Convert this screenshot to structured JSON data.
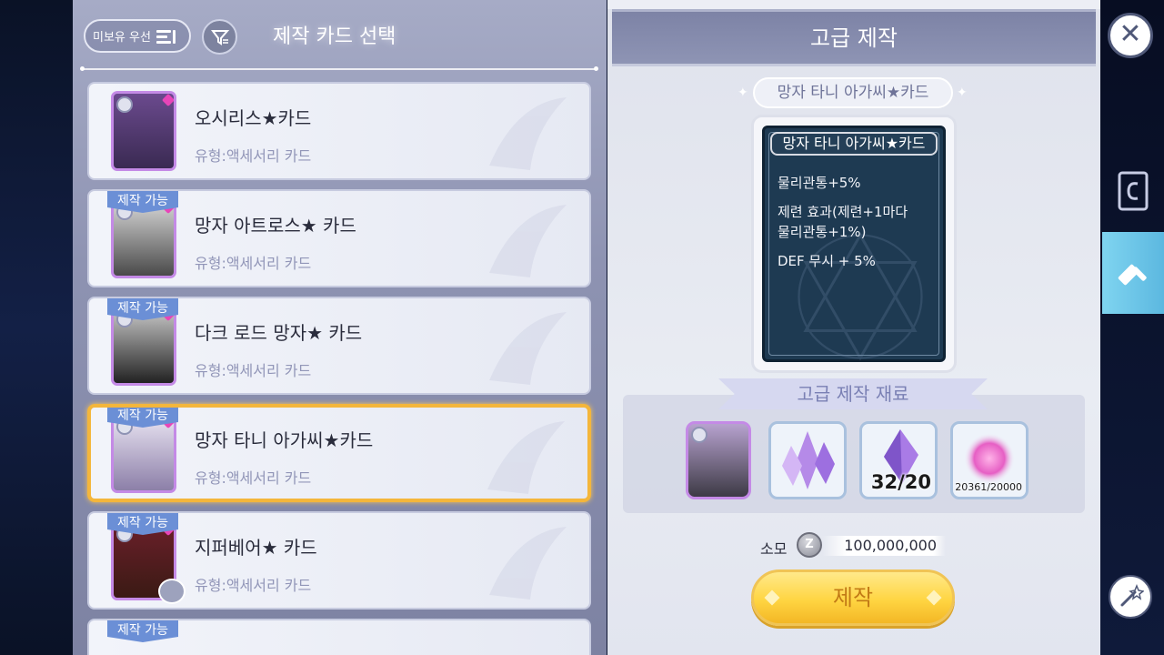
{
  "left": {
    "sort_label": "미보유 우선",
    "title": "제작 카드 선택",
    "cards": [
      {
        "name": "오시리스★카드",
        "type": "유형:액세서리 카드",
        "badge": ""
      },
      {
        "name": "망자 아트로스★ 카드",
        "type": "유형:액세서리 카드",
        "badge": "제작 가능"
      },
      {
        "name": "다크 로드 망자★ 카드",
        "type": "유형:액세서리 카드",
        "badge": "제작 가능"
      },
      {
        "name": "망자 타니 아가씨★카드",
        "type": "유형:액세서리 카드",
        "badge": "제작 가능"
      },
      {
        "name": "지퍼베어★ 카드",
        "type": "유형:액세서리 카드",
        "badge": "제작 가능"
      },
      {
        "name": "",
        "type": "",
        "badge": "제작 가능"
      }
    ]
  },
  "right": {
    "header": "고급 제작",
    "selected_card": "망자 타니 아가씨★카드",
    "detail": {
      "name": "망자 타니 아가씨★카드",
      "effects": [
        "물리관통+5%",
        "제련 효과(제련+1마다",
        "물리관통+1%)",
        "DEF 무시 + 5%"
      ]
    },
    "materials_label": "고급 제작 재료",
    "materials": [
      {
        "icon": "card-icon",
        "count": ""
      },
      {
        "icon": "crystal-cluster-icon",
        "count": ""
      },
      {
        "icon": "purple-crystal-icon",
        "count": "32/20"
      },
      {
        "icon": "pink-essence-icon",
        "count": "20361/20000"
      }
    ],
    "cost_label": "소모",
    "coin_symbol": "Z",
    "cost_value": "100,000,000",
    "craft_button": "제작"
  },
  "colors": {
    "badge": "#6b8fd6",
    "selected_border": "#f4b63b",
    "craft_button": "#ffd542",
    "active_tab": "#5cb8e0"
  }
}
